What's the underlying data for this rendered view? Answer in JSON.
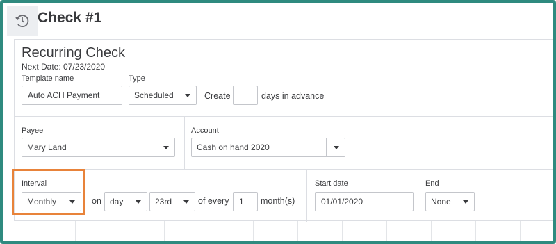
{
  "header": {
    "title": "Check #1",
    "icon": "recurring-history-icon"
  },
  "recurring": {
    "section_title": "Recurring Check",
    "next_date": "Next Date: 07/23/2020",
    "template_name_label": "Template name",
    "template_name_value": "Auto ACH Payment",
    "type_label": "Type",
    "type_value": "Scheduled",
    "create_label": "Create",
    "create_value": "",
    "days_label": "days in advance"
  },
  "payee": {
    "label": "Payee",
    "value": "Mary Land"
  },
  "account": {
    "label": "Account",
    "value": "Cash on hand 2020"
  },
  "interval": {
    "label": "Interval",
    "frequency": "Monthly",
    "on_label": "on",
    "unit": "day",
    "day": "23rd",
    "every_label": "of every",
    "every_value": "1",
    "months_label": "month(s)"
  },
  "dates": {
    "start_label": "Start date",
    "start_value": "01/01/2020",
    "end_label": "End",
    "end_value": "None"
  },
  "colors": {
    "frame": "#2f8a7f",
    "highlight": "#e8833a"
  }
}
